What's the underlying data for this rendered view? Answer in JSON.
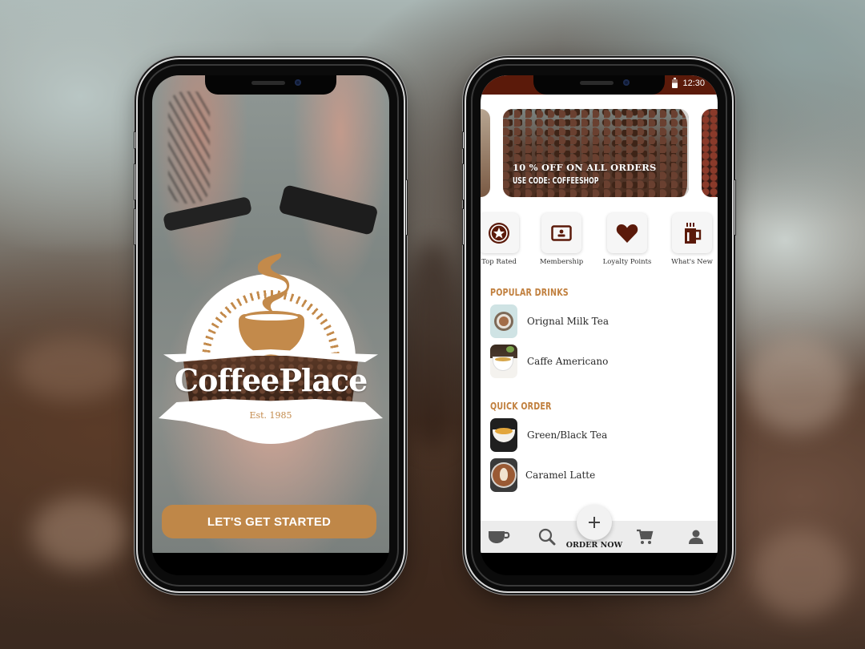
{
  "splash_screen": {
    "brand_name": "CoffeePlace",
    "established": "Est. 1985",
    "cta_label": "LET'S GET STARTED",
    "accent_color": "#bf8748"
  },
  "home_screen": {
    "status_bar": {
      "time": "12:30",
      "battery_icon": "battery-icon",
      "color": "#5b1a0a"
    },
    "promo_banner": {
      "title": "10 % OFF ON ALL ORDERS",
      "subtitle": "USE CODE: COFFEESHOP"
    },
    "quick_links": [
      {
        "label": "Top Rated",
        "icon": "star-badge-icon"
      },
      {
        "label": "Membership",
        "icon": "id-card-icon"
      },
      {
        "label": "Loyalty Points",
        "icon": "heart-icon"
      },
      {
        "label": "What's New",
        "icon": "hot-drink-mug-icon"
      }
    ],
    "popular_drinks": {
      "title": "POPULAR DRINKS",
      "items": [
        {
          "name": "Orignal Milk Tea"
        },
        {
          "name": "Caffe Americano"
        }
      ]
    },
    "quick_order": {
      "title": "QUICK ORDER",
      "items": [
        {
          "name": "Green/Black Tea"
        },
        {
          "name": "Caramel Latte"
        }
      ]
    },
    "tab_bar": {
      "tabs": [
        {
          "name": "Home",
          "icon": "coffee-cup-icon"
        },
        {
          "name": "Search",
          "icon": "search-icon"
        },
        {
          "name": "Cart",
          "icon": "cart-icon"
        },
        {
          "name": "Profile",
          "icon": "user-icon"
        }
      ],
      "fab_icon": "plus-icon",
      "fab_label": "ORDER NOW"
    },
    "colors": {
      "primary": "#5b1a0a",
      "section_title": "#c1803f",
      "icon": "#5b1a0a"
    }
  }
}
